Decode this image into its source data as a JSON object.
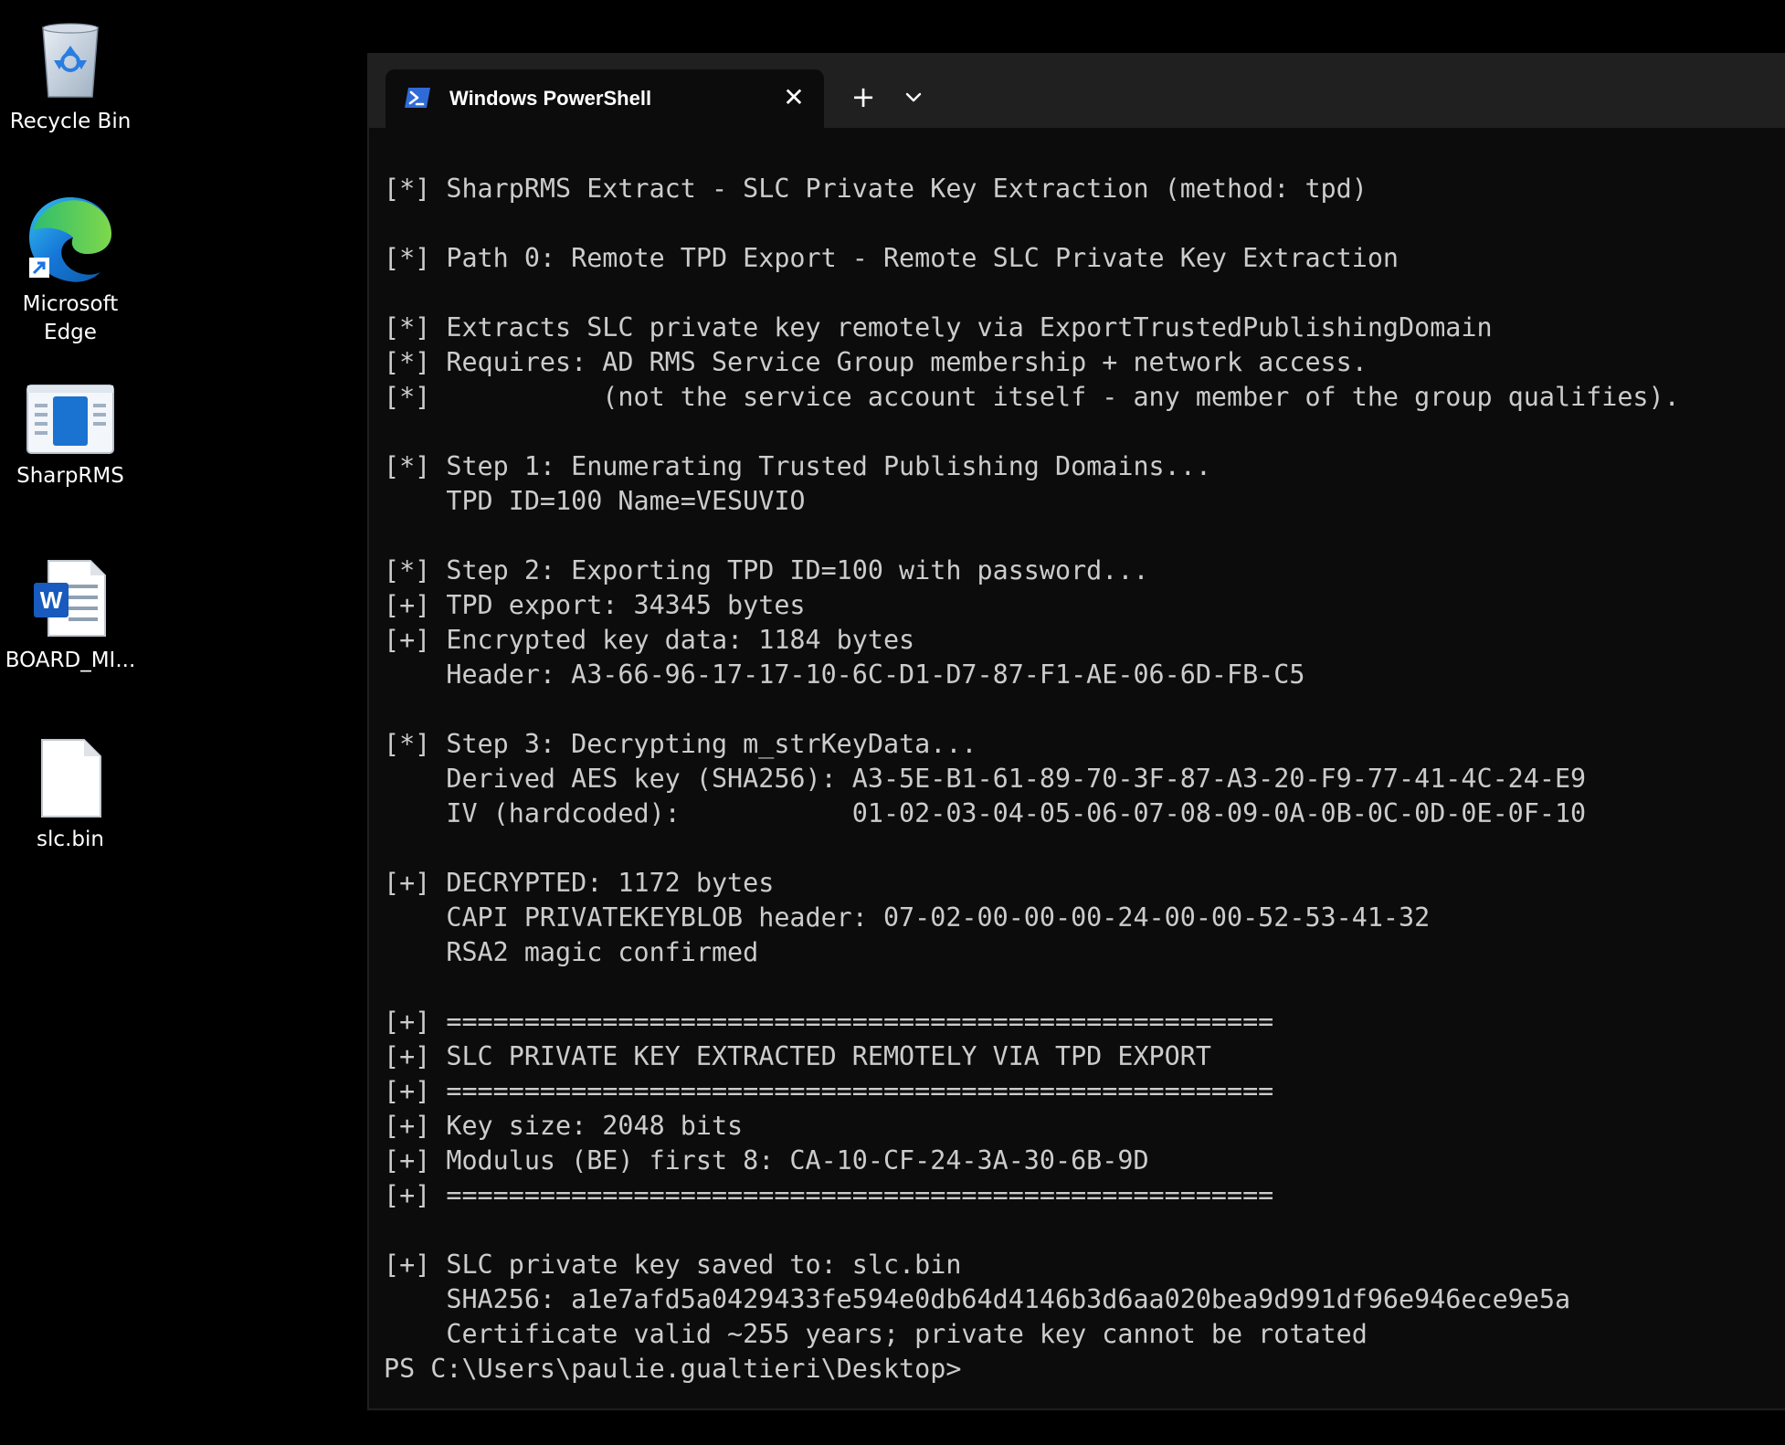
{
  "desktop": {
    "icons": [
      {
        "label": "Recycle Bin",
        "icon": "recycle-bin-icon"
      },
      {
        "label": "Microsoft Edge",
        "icon": "edge-icon"
      },
      {
        "label": "SharpRMS",
        "icon": "sharprms-icon"
      },
      {
        "label": "BOARD_MI...",
        "icon": "word-document-icon"
      },
      {
        "label": "slc.bin",
        "icon": "file-icon"
      }
    ]
  },
  "terminal": {
    "tab_title": "Windows PowerShell",
    "tab_close_glyph": "✕",
    "new_tab_glyph": "+",
    "lines": [
      "[*] SharpRMS Extract - SLC Private Key Extraction (method: tpd)",
      "",
      "[*] Path 0: Remote TPD Export - Remote SLC Private Key Extraction",
      "",
      "[*] Extracts SLC private key remotely via ExportTrustedPublishingDomain",
      "[*] Requires: AD RMS Service Group membership + network access.",
      "[*]           (not the service account itself - any member of the group qualifies).",
      "",
      "[*] Step 1: Enumerating Trusted Publishing Domains...",
      "    TPD ID=100 Name=VESUVIO",
      "",
      "[*] Step 2: Exporting TPD ID=100 with password...",
      "[+] TPD export: 34345 bytes",
      "[+] Encrypted key data: 1184 bytes",
      "    Header: A3-66-96-17-17-10-6C-D1-D7-87-F1-AE-06-6D-FB-C5",
      "",
      "[*] Step 3: Decrypting m_strKeyData...",
      "    Derived AES key (SHA256): A3-5E-B1-61-89-70-3F-87-A3-20-F9-77-41-4C-24-E9",
      "    IV (hardcoded):           01-02-03-04-05-06-07-08-09-0A-0B-0C-0D-0E-0F-10",
      "",
      "[+] DECRYPTED: 1172 bytes",
      "    CAPI PRIVATEKEYBLOB header: 07-02-00-00-00-24-00-00-52-53-41-32",
      "    RSA2 magic confirmed",
      "",
      "[+] =====================================================",
      "[+] SLC PRIVATE KEY EXTRACTED REMOTELY VIA TPD EXPORT",
      "[+] =====================================================",
      "[+] Key size: 2048 bits",
      "[+] Modulus (BE) first 8: CA-10-CF-24-3A-30-6B-9D",
      "[+] =====================================================",
      "",
      "[+] SLC private key saved to: slc.bin",
      "    SHA256: a1e7afd5a0429433fe594e0db64d4146b3d6aa020bea9d991df96e946ece9e5a",
      "    Certificate valid ~255 years; private key cannot be rotated",
      "PS C:\\Users\\paulie.gualtieri\\Desktop>"
    ]
  },
  "colors": {
    "desktop_bg": "#000000",
    "terminal_bg": "#0c0c0c",
    "tabbar_bg": "#202020",
    "terminal_text": "#cccccc",
    "powershell_accent": "#2f6bd8"
  }
}
